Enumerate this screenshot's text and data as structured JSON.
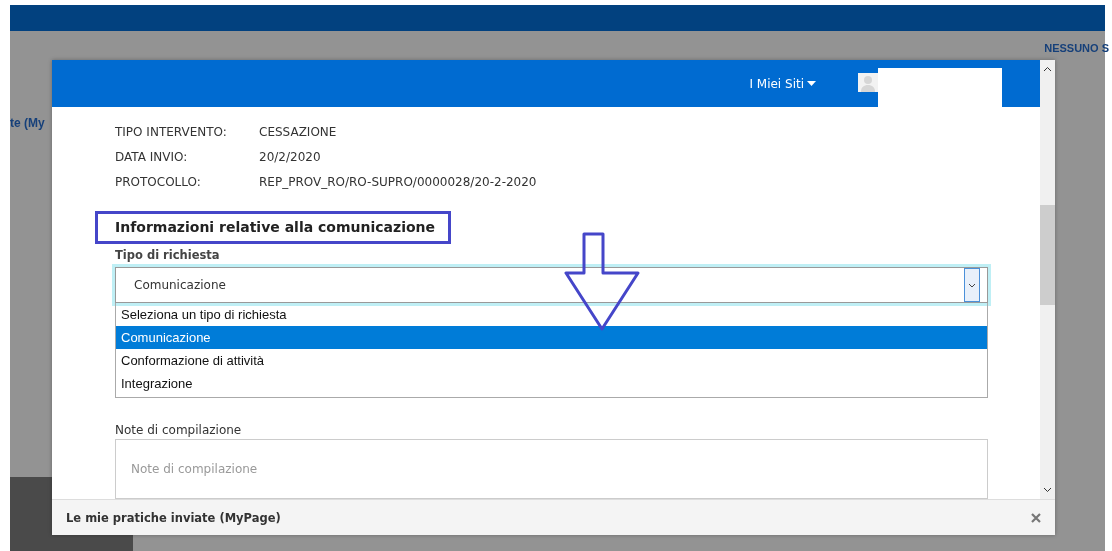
{
  "background": {
    "top_right_label": "NESSUNO S",
    "left_link": "te (My"
  },
  "modal": {
    "header": {
      "menu": "I Miei Siti"
    },
    "details": [
      {
        "label": "TIPO INTERVENTO:",
        "value": "CESSAZIONE"
      },
      {
        "label": "DATA INVIO:",
        "value": "20/2/2020"
      },
      {
        "label": "PROTOCOLLO:",
        "value": "REP_PROV_RO/RO-SUPRO/0000028/20-2-2020"
      }
    ],
    "section_title": "Informazioni relative alla comunicazione",
    "request_type": {
      "label": "Tipo di richiesta",
      "value": "Comunicazione",
      "expanded": true,
      "options": [
        {
          "label": "Seleziona un tipo di richiesta",
          "selected": false
        },
        {
          "label": "Comunicazione",
          "selected": true
        },
        {
          "label": "Conformazione di attività",
          "selected": false
        },
        {
          "label": "Integrazione",
          "selected": false
        }
      ]
    },
    "notes": {
      "label": "Note di compilazione",
      "placeholder": "Note di compilazione"
    },
    "footer": {
      "title": "Le mie pratiche inviate (MyPage)"
    }
  }
}
